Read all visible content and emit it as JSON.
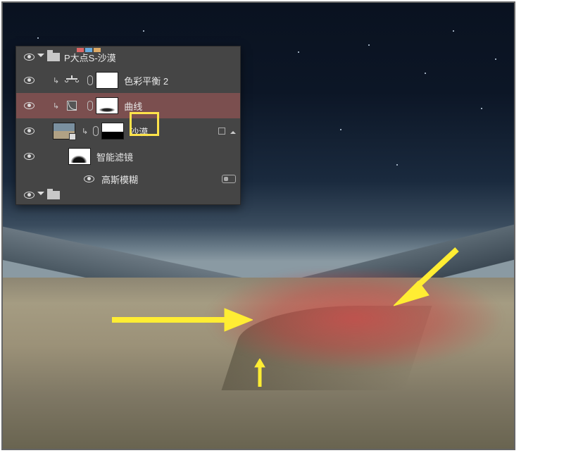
{
  "layers_panel": {
    "group_name": "P大点S-沙漠",
    "items": [
      {
        "label": "色彩平衡 2"
      },
      {
        "label": "曲线"
      },
      {
        "label": "沙漠"
      },
      {
        "label": "智能滤镜"
      },
      {
        "label": "高斯模糊"
      }
    ],
    "colors": {
      "panel_bg": "#454545",
      "selected_bg": "#7b4f4f",
      "highlight_box": "#ffe34a",
      "arrow": "#ffed33"
    }
  }
}
